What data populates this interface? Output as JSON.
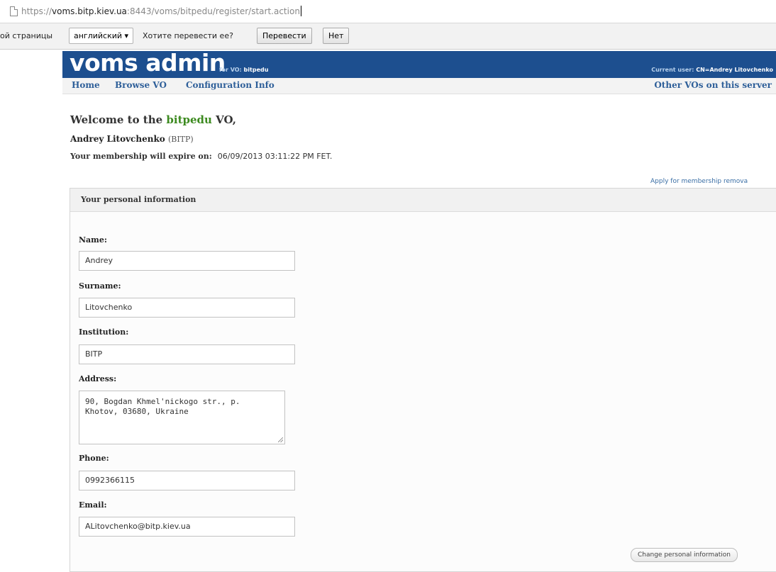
{
  "browser": {
    "url_prefix": "https://",
    "url_host": "voms.bitp.kiev.ua",
    "url_rest": ":8443/voms/bitpedu/register/start.action"
  },
  "translate_bar": {
    "text_left": "ой страницы",
    "language_select": "английский ▾",
    "question": "Хотите перевести ее?",
    "translate_button": "Перевести",
    "no_button": "Нет"
  },
  "header": {
    "logo": "voms admin",
    "for_vo_prefix": "for VO: ",
    "for_vo_name": "bitpedu",
    "current_user_prefix": "Current user: ",
    "current_user": "CN=Andrey Litovchenko"
  },
  "nav": {
    "home": "Home",
    "browse_vo": "Browse VO",
    "config_info": "Configuration Info",
    "other_vos": "Other VOs on this server"
  },
  "welcome": {
    "prefix": "Welcome to the ",
    "vo": "bitpedu",
    "suffix": " VO,",
    "user_name": "Andrey Litovchenko",
    "institution": "(BITP)",
    "expire_label": "Your membership will expire on:",
    "expire_date": "06/09/2013 03:11:22 PM FET."
  },
  "apply_link": "Apply for membership remova",
  "personal": {
    "title": "Your personal information",
    "name_label": "Name:",
    "name_value": "Andrey",
    "surname_label": "Surname:",
    "surname_value": "Litovchenko",
    "institution_label": "Institution:",
    "institution_value": "BITP",
    "address_label": "Address:",
    "address_value": "90, Bogdan Khmel'nickogo str., p.\nKhotov, 03680, Ukraine",
    "phone_label": "Phone:",
    "phone_value": "0992366115",
    "email_label": "Email:",
    "email_value": "ALitovchenko@bitp.kiev.ua",
    "change_button": "Change personal information"
  }
}
